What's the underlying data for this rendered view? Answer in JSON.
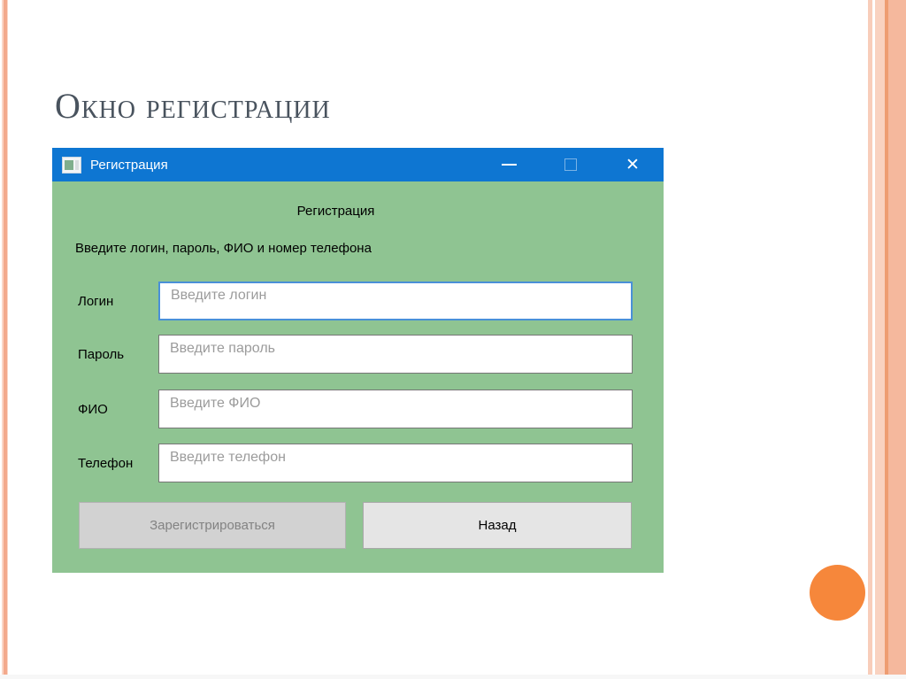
{
  "slide": {
    "title": "Окно регистрации"
  },
  "window": {
    "title": "Регистрация",
    "icons": {
      "app_icon": "form-window-icon",
      "minimize_icon": "minimize-dash",
      "maximize_icon": "maximize-square",
      "close_glyph": "✕"
    },
    "form": {
      "heading": "Регистрация",
      "instruction": "Введите логин, пароль, ФИО и номер телефона",
      "fields": [
        {
          "label": "Логин",
          "placeholder": "Введите логин",
          "value": "",
          "focused": true
        },
        {
          "label": "Пароль",
          "placeholder": "Введите пароль",
          "value": "",
          "focused": false
        },
        {
          "label": "ФИО",
          "placeholder": "Введите ФИО",
          "value": "",
          "focused": false
        },
        {
          "label": "Телефон",
          "placeholder": "Введите телефон",
          "value": "",
          "focused": false
        }
      ],
      "buttons": [
        {
          "label": "Зарегистрироваться",
          "enabled": false
        },
        {
          "label": "Назад",
          "enabled": true
        }
      ]
    }
  },
  "colors": {
    "titlebar_blue": "#0e76d2",
    "content_green": "#8fc492",
    "accent_orange": "#f6873b",
    "stripe_salmon": "#f3a98c",
    "focused_input_border": "#4a90d8",
    "slide_title_text": "#49535e"
  }
}
